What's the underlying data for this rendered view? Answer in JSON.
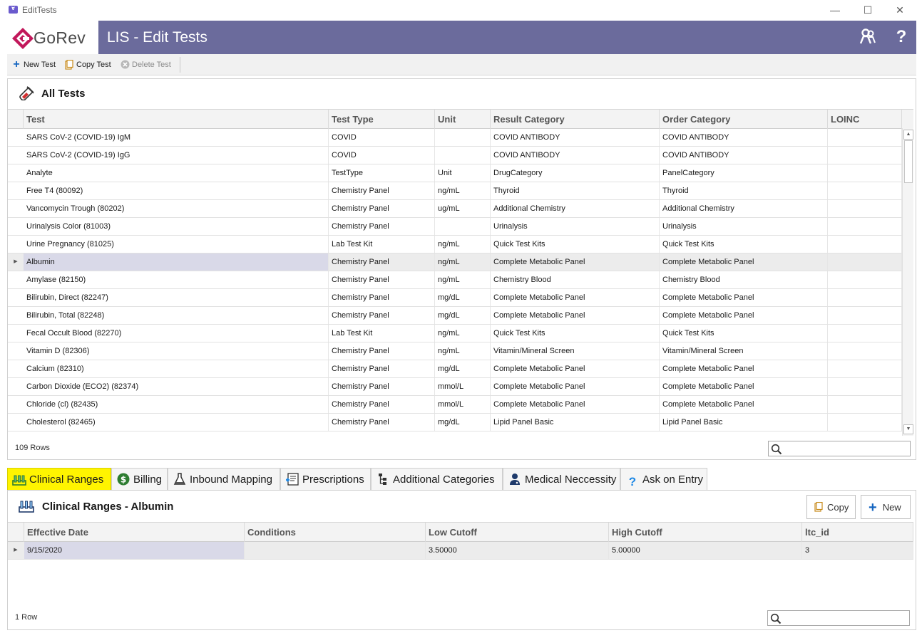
{
  "window": {
    "title": "EditTests",
    "app_icon_text": "Ɐ",
    "minimize": "—",
    "maximize": "☐",
    "close": "✕"
  },
  "header": {
    "logo_text": "GoRev",
    "title": "LIS - Edit Tests",
    "users_icon": "users-icon",
    "help_label": "?"
  },
  "toolbar": {
    "new_test": "New Test",
    "copy_test": "Copy Test",
    "delete_test": "Delete Test"
  },
  "colors": {
    "banner": "#6b6b9c",
    "active_tab": "#fff400",
    "selected_row": "#ececec",
    "plus_blue": "#1565c0",
    "logo_magenta": "#c2185b"
  },
  "all_tests": {
    "title": "All Tests",
    "columns": [
      "Test",
      "Test Type",
      "Unit",
      "Result Category",
      "Order Category",
      "LOINC"
    ],
    "rows": [
      [
        "SARS CoV-2 (COVID-19) IgM",
        "COVID",
        "",
        "COVID ANTIBODY",
        "COVID ANTIBODY",
        ""
      ],
      [
        "SARS CoV-2 (COVID-19) IgG",
        "COVID",
        "",
        "COVID ANTIBODY",
        "COVID ANTIBODY",
        ""
      ],
      [
        "Analyte",
        "TestType",
        "Unit",
        "DrugCategory",
        "PanelCategory",
        ""
      ],
      [
        "Free T4 (80092)",
        "Chemistry Panel",
        "ng/mL",
        "Thyroid",
        "Thyroid",
        ""
      ],
      [
        "Vancomycin Trough (80202)",
        "Chemistry Panel",
        "ug/mL",
        "Additional Chemistry",
        "Additional Chemistry",
        ""
      ],
      [
        "Urinalysis Color (81003)",
        "Chemistry Panel",
        "",
        "Urinalysis",
        "Urinalysis",
        ""
      ],
      [
        "Urine Pregnancy (81025)",
        "Lab Test Kit",
        "ng/mL",
        "Quick Test Kits",
        "Quick Test Kits",
        ""
      ],
      [
        "Albumin",
        "Chemistry Panel",
        "ng/mL",
        "Complete Metabolic Panel",
        "Complete Metabolic Panel",
        ""
      ],
      [
        "Amylase (82150)",
        "Chemistry Panel",
        "ng/mL",
        "Chemistry Blood",
        "Chemistry Blood",
        ""
      ],
      [
        "Bilirubin, Direct (82247)",
        "Chemistry Panel",
        "mg/dL",
        "Complete Metabolic Panel",
        "Complete Metabolic Panel",
        ""
      ],
      [
        "Bilirubin, Total (82248)",
        "Chemistry Panel",
        "mg/dL",
        "Complete Metabolic Panel",
        "Complete Metabolic Panel",
        ""
      ],
      [
        "Fecal Occult Blood (82270)",
        "Lab Test Kit",
        "ng/mL",
        "Quick Test Kits",
        "Quick Test Kits",
        ""
      ],
      [
        "Vitamin D (82306)",
        "Chemistry Panel",
        "ng/mL",
        "Vitamin/Mineral Screen",
        "Vitamin/Mineral Screen",
        ""
      ],
      [
        "Calcium (82310)",
        "Chemistry Panel",
        "mg/dL",
        "Complete Metabolic Panel",
        "Complete Metabolic Panel",
        ""
      ],
      [
        "Carbon Dioxide (ECO2) (82374)",
        "Chemistry Panel",
        "mmol/L",
        "Complete Metabolic Panel",
        "Complete Metabolic Panel",
        ""
      ],
      [
        "Chloride (cl) (82435)",
        "Chemistry Panel",
        "mmol/L",
        "Complete Metabolic Panel",
        "Complete Metabolic Panel",
        ""
      ],
      [
        "Cholesterol (82465)",
        "Chemistry Panel",
        "mg/dL",
        "Lipid Panel Basic",
        "Lipid Panel Basic",
        ""
      ]
    ],
    "selected_row": 7,
    "row_count": "109 Rows"
  },
  "tabs": [
    {
      "label": "Clinical Ranges",
      "icon": "test-tubes-icon",
      "active": true
    },
    {
      "label": "Billing",
      "icon": "dollar-icon",
      "active": false
    },
    {
      "label": "Inbound Mapping",
      "icon": "flask-icon",
      "active": false
    },
    {
      "label": "Prescriptions",
      "icon": "prescription-icon",
      "active": false
    },
    {
      "label": "Additional Categories",
      "icon": "hierarchy-icon",
      "active": false
    },
    {
      "label": "Medical Neccessity",
      "icon": "doctor-icon",
      "active": false
    },
    {
      "label": "Ask on Entry",
      "icon": "question-icon",
      "active": false
    }
  ],
  "clinical_ranges": {
    "title": "Clinical Ranges - Albumin",
    "copy_label": "Copy",
    "new_label": "New",
    "columns": [
      "Effective Date",
      "Conditions",
      "Low Cutoff",
      "High Cutoff",
      "ltc_id"
    ],
    "rows": [
      [
        "9/15/2020",
        "",
        "3.50000",
        "5.00000",
        "3"
      ]
    ],
    "row_count": "1 Row"
  }
}
